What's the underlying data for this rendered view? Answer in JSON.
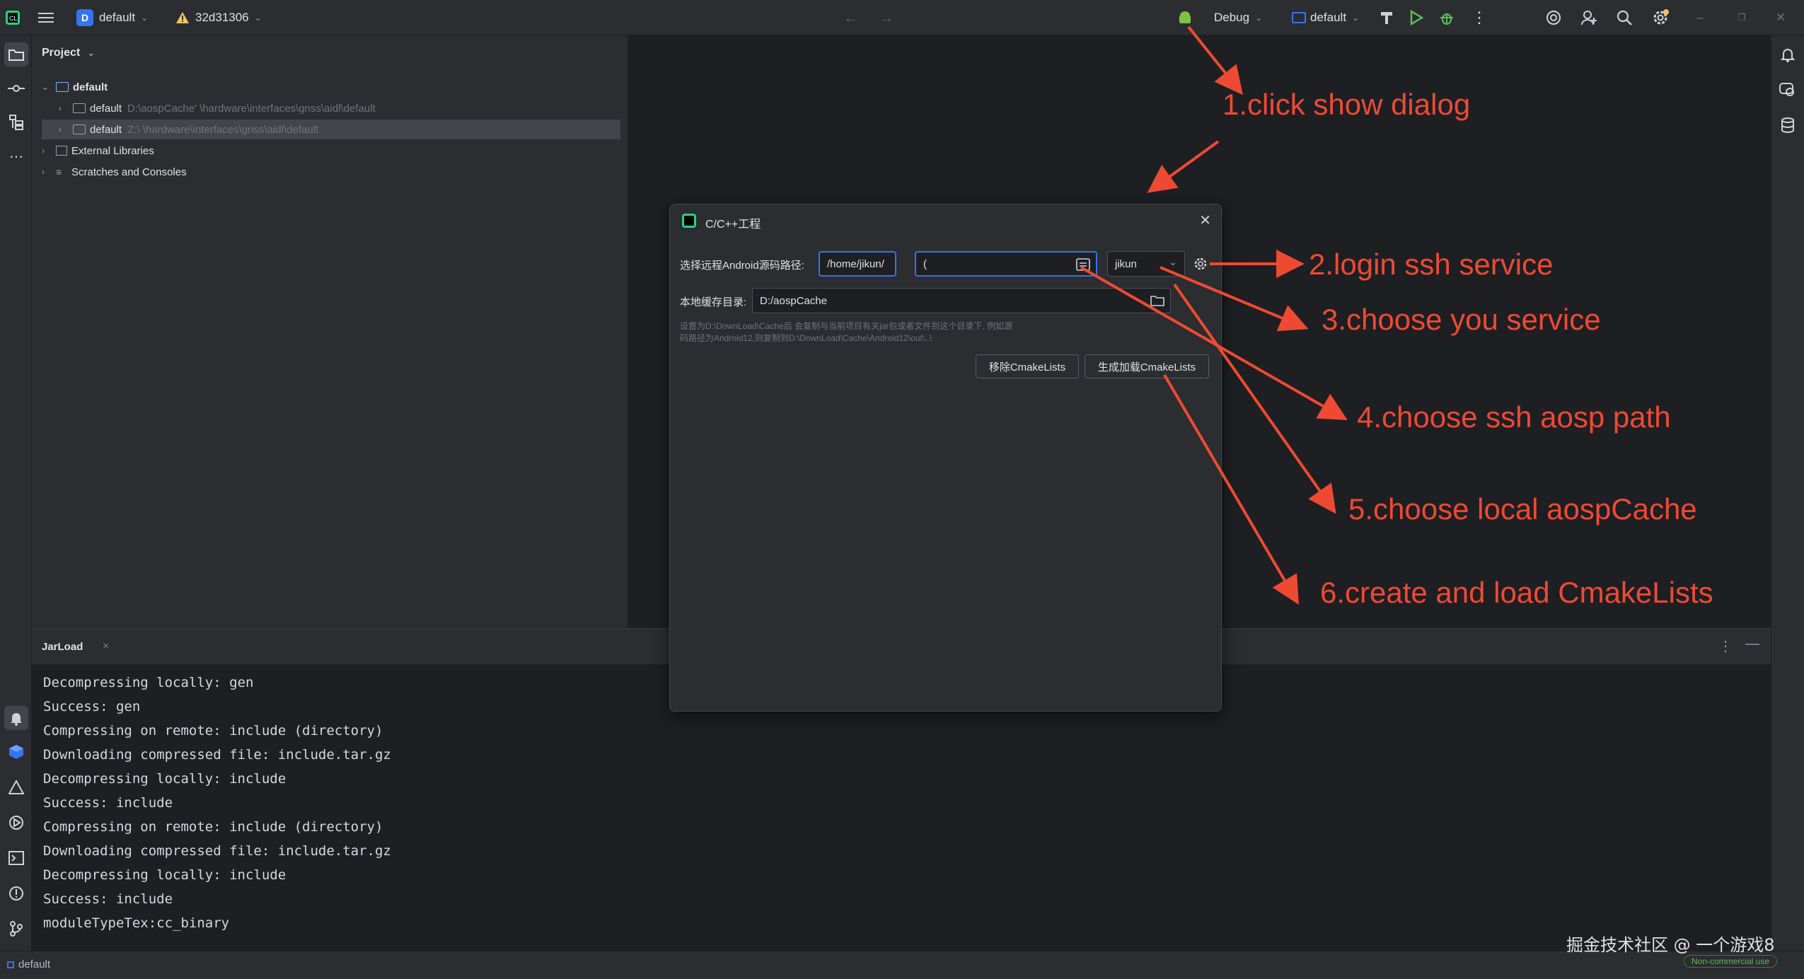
{
  "titlebar": {
    "project_badge": "D",
    "project_name": "default",
    "branch": "32d31306",
    "run_config": "Debug",
    "device": "default"
  },
  "project_panel": {
    "title": "Project",
    "tree": [
      {
        "label": "default",
        "path": ""
      },
      {
        "label": "default",
        "path": "D:\\aospCache'        \\hardware\\interfaces\\gnss\\aidl\\default"
      },
      {
        "label": "default",
        "path": "Z:\\              \\hardware\\interfaces\\gnss\\aidl\\default"
      },
      {
        "label": "External Libraries",
        "path": ""
      },
      {
        "label": "Scratches and Consoles",
        "path": ""
      }
    ]
  },
  "dialog": {
    "title": "C/C++工程",
    "remote_label": "选择远程Android源码路径:",
    "remote_path_value": "/home/jikun/",
    "remote_path_value2": "(",
    "server_select": "jikun",
    "local_label": "本地缓存目录:",
    "local_value": "D:/aospCache",
    "hint_line1": "设置为D:\\DownLoad\\Cache后 会复制与当前项目有关jar包或者文件到这个目录下, 例如源",
    "hint_line2": "码路径为Android12,则复制到D:\\DownLoad\\Cache\\Android12\\out\\..\\",
    "remove_button": "移除CmakeLists",
    "generate_button": "生成加载CmakeLists"
  },
  "bottom_panel": {
    "tab": "JarLoad",
    "lines": [
      "Decompressing locally: gen",
      "Success: gen",
      "Compressing on remote: include (directory)",
      "Downloading compressed file: include.tar.gz",
      "Decompressing locally: include",
      "Success: include",
      "Compressing on remote: include (directory)",
      "Downloading compressed file: include.tar.gz",
      "Decompressing locally: include",
      "Success: include",
      "moduleTypeTex:cc_binary"
    ]
  },
  "statusbar": {
    "project": "default",
    "license": "Non-commercial use"
  },
  "annotations": [
    "1.click show dialog",
    "2.login ssh service",
    "3.choose you service",
    "4.choose ssh aosp path",
    "5.choose local aospCache",
    "6.create and load CmakeLists"
  ],
  "watermark": "掘金技术社区 @ 一个游戏8",
  "colors": {
    "accent": "#3574f0",
    "annotation": "#ee4a33",
    "background": "#1e1f22",
    "panel": "#2b2d30"
  }
}
